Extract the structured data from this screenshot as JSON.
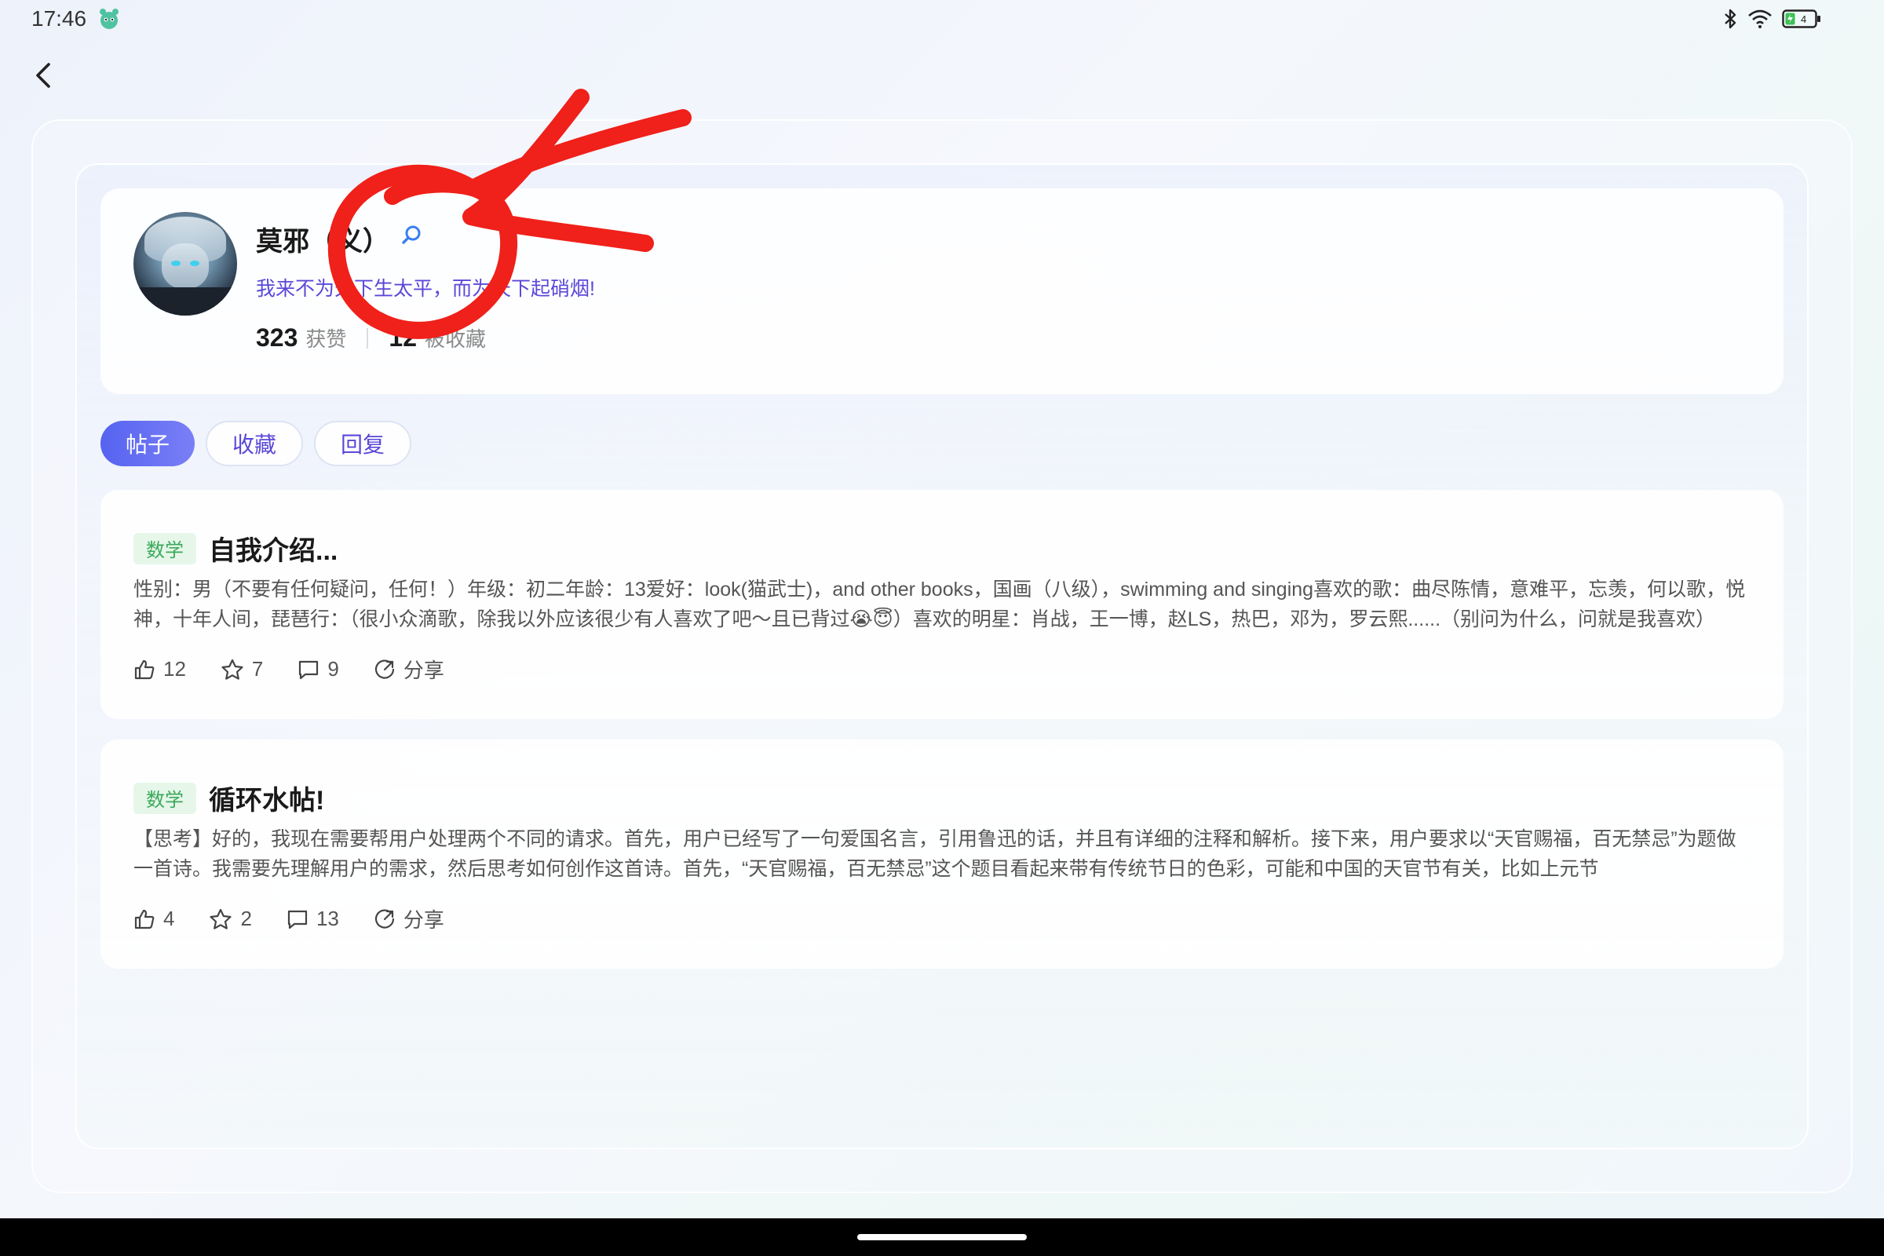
{
  "status_bar": {
    "time": "17:46",
    "battery_level": "4",
    "icons": [
      "mascot-icon",
      "bluetooth-icon",
      "wifi-icon",
      "battery-charging-icon"
    ]
  },
  "profile": {
    "name": "莫邪（义）",
    "motto": "我来不为天下生太平，而为天下起硝烟!",
    "likes_count": "323",
    "likes_label": "获赞",
    "favorited_count": "12",
    "favorited_label": "被收藏"
  },
  "tabs": [
    {
      "label": "帖子",
      "active": true
    },
    {
      "label": "收藏",
      "active": false
    },
    {
      "label": "回复",
      "active": false
    }
  ],
  "posts": [
    {
      "tag": "数学",
      "title": "自我介绍...",
      "body": "性别：男（不要有任何疑问，任何！）年级：初二年龄：13爱好：look(猫武士)，and other books，国画（八级），swimming and singing喜欢的歌：曲尽陈情，意难平，忘羡，何以歌，悦神，十年人间，琵琶行：（很小众滴歌，除我以外应该很少有人喜欢了吧～且已背过😭😇）喜欢的明星：肖战，王一博，赵LS，热巴，邓为，罗云熙......（别问为什么，问就是我喜欢）",
      "likes": "12",
      "stars": "7",
      "comments": "9",
      "share_label": "分享"
    },
    {
      "tag": "数学",
      "title": "循环水帖!",
      "body": "【思考】好的，我现在需要帮用户处理两个不同的请求。首先，用户已经写了一句爱国名言，引用鲁迅的话，并且有详细的注释和解析。接下来，用户要求以“天官赐福，百无禁忌”为题做一首诗。我需要先理解用户的需求，然后思考如何创作这首诗。首先，“天官赐福，百无禁忌”这个题目看起来带有传统节日的色彩，可能和中国的天官节有关，比如上元节",
      "likes": "4",
      "stars": "2",
      "comments": "13",
      "share_label": "分享"
    }
  ],
  "colors": {
    "accent": "#5563f0",
    "motto": "#5a48d8",
    "tag_bg": "#e6f7ea",
    "tag_text": "#3ca95a",
    "annotation": "#f0201a"
  }
}
